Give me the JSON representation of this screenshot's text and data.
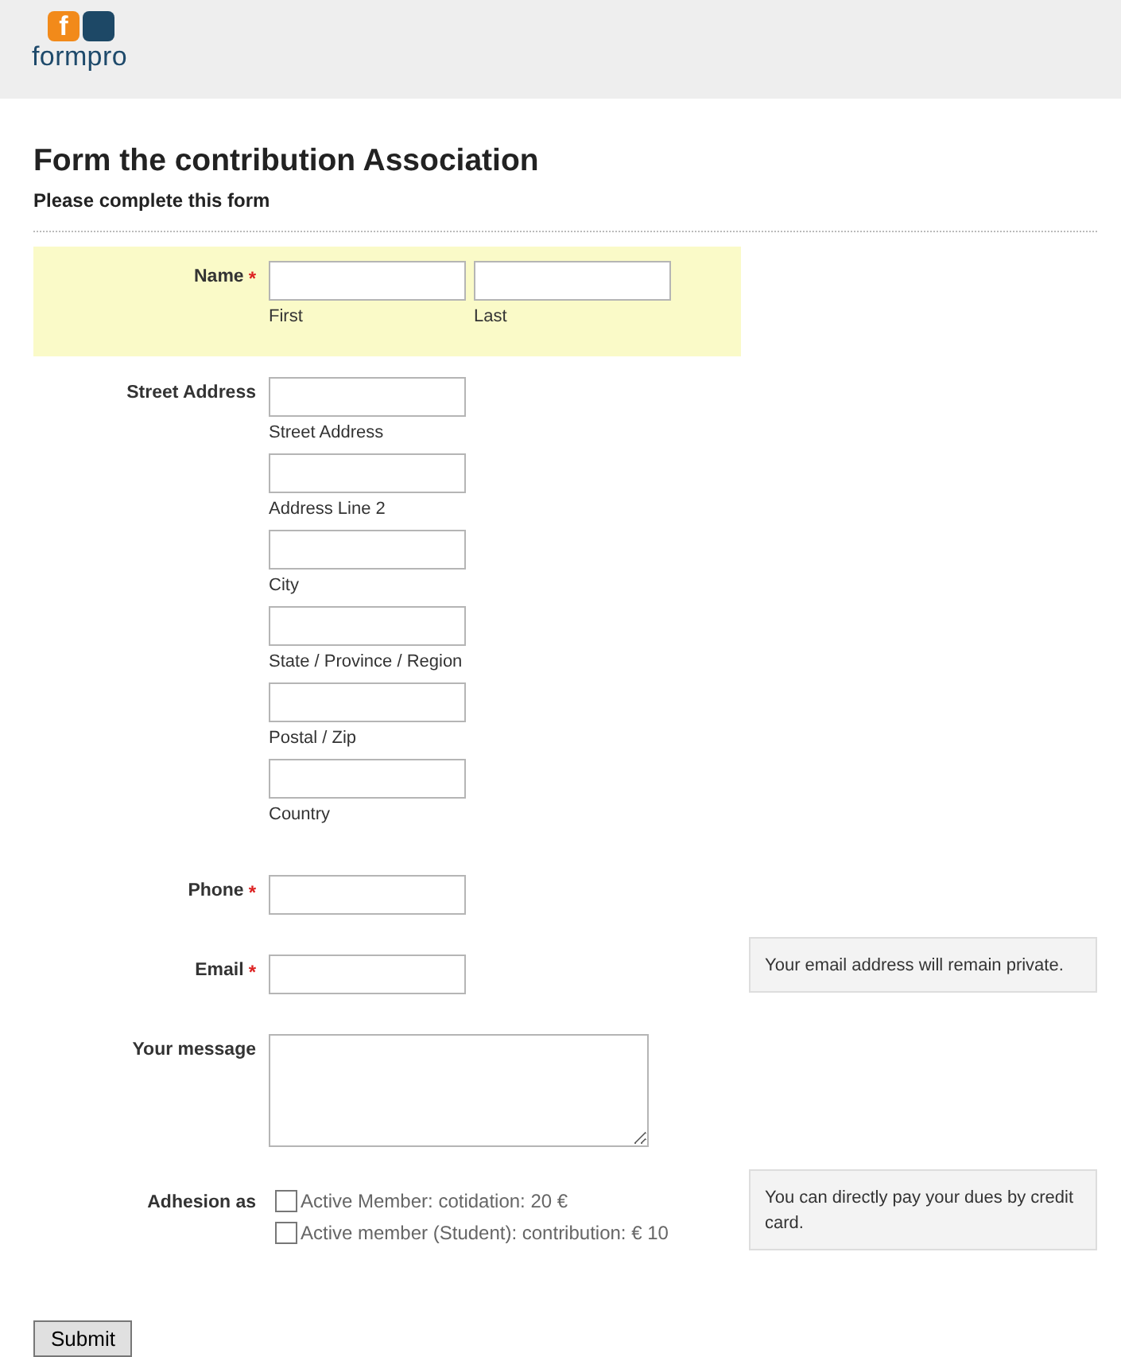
{
  "logo": {
    "mark": "f",
    "name": "formpro"
  },
  "form": {
    "title": "Form the contribution Association",
    "subtitle": "Please complete this form"
  },
  "fields": [
    {
      "kind": "name",
      "label": "Name",
      "required_mark": "*",
      "highlighted": true,
      "inputs": [
        {
          "sublabel": "First"
        },
        {
          "sublabel": "Last"
        }
      ]
    },
    {
      "kind": "address",
      "label": "Street Address",
      "highlighted": false,
      "inputs": [
        {
          "sublabel": "Street Address"
        },
        {
          "sublabel": "Address Line 2"
        },
        {
          "sublabel": "City"
        },
        {
          "sublabel": "State / Province / Region"
        },
        {
          "sublabel": "Postal / Zip"
        },
        {
          "sublabel": "Country"
        }
      ]
    },
    {
      "kind": "text",
      "label": "Phone",
      "required_mark": "*",
      "highlighted": false
    },
    {
      "kind": "text",
      "label": "Email",
      "required_mark": "*",
      "highlighted": false,
      "hint": "Your email address will remain private."
    },
    {
      "kind": "textarea",
      "label": "Your message",
      "highlighted": false
    },
    {
      "kind": "checkboxes",
      "label": "Adhesion as",
      "highlighted": false,
      "hint": "You can directly pay your dues by credit card.",
      "options": [
        {
          "label": "Active Member: cotidation: 20 €",
          "checked": false
        },
        {
          "label": "Active member (Student): contribution: € 10",
          "checked": false
        }
      ]
    }
  ],
  "submit": "Submit"
}
